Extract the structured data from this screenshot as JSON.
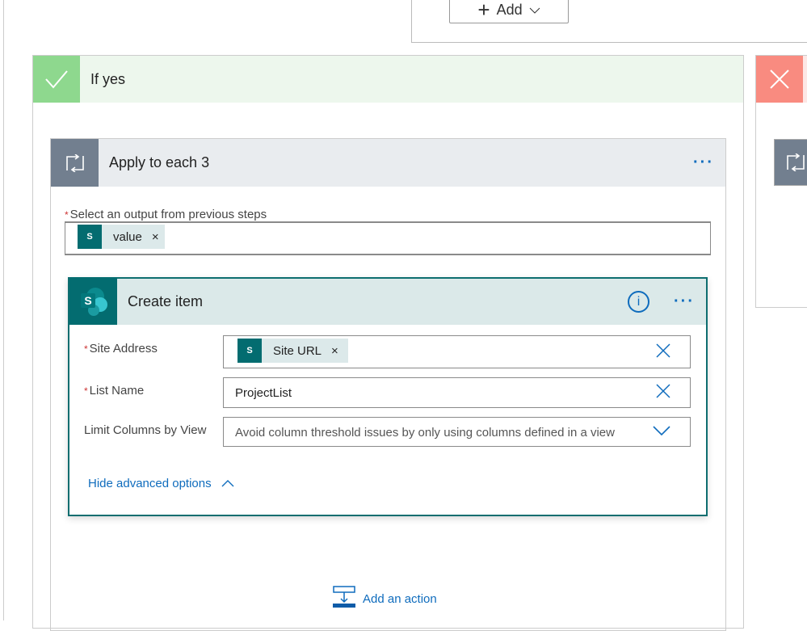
{
  "top": {
    "add_label": "Add"
  },
  "if_yes": {
    "title": "If yes",
    "color": "#8ed88e"
  },
  "if_no": {
    "color": "#f98b80"
  },
  "apply_each": {
    "title": "Apply to each 3",
    "more": "···",
    "output_label": "Select an output from previous steps",
    "token": "value"
  },
  "create_item": {
    "title": "Create item",
    "more": "···",
    "icon_letter": "S",
    "fields": [
      {
        "label": "Site Address",
        "required": true,
        "token": "Site URL"
      },
      {
        "label": "List Name",
        "required": true,
        "value": "ProjectList"
      },
      {
        "label": "Limit Columns by View",
        "required": false,
        "placeholder": "Avoid column threshold issues by only using columns defined in a view"
      }
    ],
    "advanced_toggle": "Hide advanced options"
  },
  "add_action": "Add an action",
  "colors": {
    "accent": "#0f6cbd",
    "sharepoint": "#036c70"
  }
}
